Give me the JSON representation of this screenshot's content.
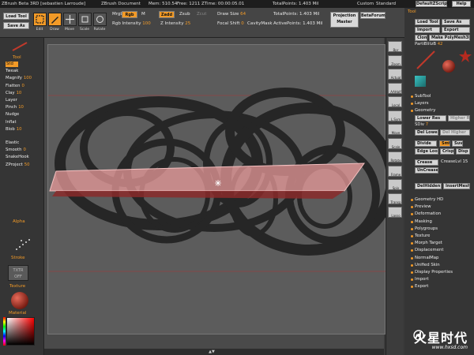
{
  "titlebar": {
    "app": "ZBrush Beta 3RD [sebastien Larroude]",
    "doc": "ZBrush Document",
    "mem": "Mem: 510.54",
    "free": "Free: 1211",
    "ztime": "ZTime: 00:00:05.01",
    "totalpoints": "TotalPoints: 1.403 Mil",
    "custom": "Custom",
    "standard": "Standard",
    "script_btn": "DefaultZScript",
    "help_btn": "Help"
  },
  "topshelf": {
    "load_tool": "Load Tool",
    "save_as": "Save As",
    "edit": "Edit",
    "draw": "Draw",
    "move": "Move",
    "scale": "Scale",
    "rotate": "Rotate",
    "mrgb": "Mrgb",
    "rgb": "Rgb",
    "m": "M",
    "rgb_intensity_label": "Rgb Intensity",
    "rgb_intensity_value": "100",
    "zadd": "Zadd",
    "zsub": "Zsub",
    "zcut": "Zcut",
    "z_intensity_label": "Z Intensity",
    "z_intensity_value": "25",
    "draw_size_label": "Draw Size",
    "draw_size_value": "64",
    "focal_shift_label": "Focal Shift",
    "focal_shift_value": "0",
    "cavity_mask": "CavityMask",
    "total_points": "TotalPoints: 1.403 Mil",
    "active_points": "ActivePoints: 1.403 Mil",
    "projection_master": "Projection Master",
    "betaforum": "BetaForum"
  },
  "lefttray": {
    "tool_head": "Tool",
    "brushes": [
      {
        "label": "Std",
        "value": ""
      },
      {
        "label": "Tweak",
        "value": ""
      },
      {
        "label": "Magnify",
        "value": "100"
      },
      {
        "label": "Flatten",
        "value": "0"
      },
      {
        "label": "Clay",
        "value": "10"
      },
      {
        "label": "Layer",
        "value": ""
      },
      {
        "label": "Pinch",
        "value": "10"
      },
      {
        "label": "Nudge",
        "value": ""
      },
      {
        "label": "Inflat",
        "value": ""
      },
      {
        "label": "Blob",
        "value": "10"
      },
      {
        "label": "Elastic",
        "value": ""
      },
      {
        "label": "Smooth",
        "value": "0"
      },
      {
        "label": "SnakeHook",
        "value": ""
      },
      {
        "label": "ZProject",
        "value": "50"
      }
    ],
    "alpha_head": "Alpha",
    "stroke_head": "Stroke",
    "texture_label": "TXTR OFF",
    "texture_head": "Texture",
    "material_head": "Material"
  },
  "rightbar": {
    "buttons": [
      "Bpr",
      "Zoom",
      "Actual",
      "AAHalf",
      "Local",
      "L.Sym",
      "Move",
      "Scale",
      "Rotate",
      "Frame",
      "Spix",
      "Transp",
      "Lasso"
    ]
  },
  "rightpal": {
    "tool_head": "Tool",
    "load_tool": "Load Tool",
    "save_as": "Save As",
    "import": "Import",
    "export": "Export",
    "clone": "Clone",
    "make_polymesh": "Make PolyMesh3D",
    "part_label": "PartiBlitzB",
    "part_value": "42",
    "subtool": "SubTool",
    "layers": "Layers",
    "geometry": "Geometry",
    "lower_res": "Lower Res",
    "higher_res": "Higher Res",
    "sdiv_label": "SDiv",
    "sdiv_value": "7",
    "del_lower": "Del Lower",
    "del_higher": "Del Higher",
    "divide": "Divide",
    "smt": "Smt",
    "suv": "Suv",
    "edge_loop": "Edge Loop",
    "crisp": "Crisp",
    "disp": "Disp",
    "crease": "Crease",
    "crease_lvl": "CreaseLvl 15",
    "uncrease": "UnCrease",
    "delhidden": "DelHidden",
    "insertmesh": "InsertMesh",
    "items": [
      "Geometry HD",
      "Preview",
      "Deformation",
      "Masking",
      "Polygroups",
      "Texture",
      "Morph Target",
      "Displacement",
      "NormalMap",
      "Unified Skin",
      "Display Properties",
      "Import",
      "Export"
    ]
  },
  "watermark": {
    "logo_text": "火星时代",
    "url": "www.hxsd.com"
  },
  "colors": {
    "accent": "#f29a27",
    "canvas": "#5c5c5c",
    "shape": "#2a2a2a",
    "selection_plane": "#e89a9a"
  }
}
